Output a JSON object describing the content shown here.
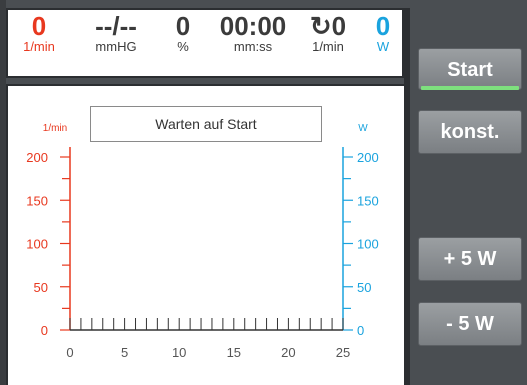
{
  "stats": [
    {
      "value": "0",
      "unit": "1/min",
      "color": "red"
    },
    {
      "value": "--/--",
      "unit": "mmHG",
      "color": "dark"
    },
    {
      "value": "0",
      "unit": "%",
      "color": "dark"
    },
    {
      "value": "00:00",
      "unit": "mm:ss",
      "color": "dark"
    },
    {
      "value": "↻0",
      "unit": "1/min",
      "color": "dark"
    },
    {
      "value": "0",
      "unit": "W",
      "color": "blue"
    }
  ],
  "status_text": "Warten auf Start",
  "buttons": {
    "start": "Start",
    "konst": "konst.",
    "plus5": "+ 5 W",
    "minus5": "- 5 W"
  },
  "colors": {
    "rpm": "#e8381f",
    "watt": "#1aa3de",
    "panel_bg": "#4a4e52",
    "button": "#8b8f92",
    "start_indicator": "#7ee07e"
  },
  "chart_data": {
    "type": "line",
    "title": "",
    "left_axis": {
      "label": "1/min",
      "ticks": [
        "0",
        "50",
        "100",
        "150",
        "200"
      ],
      "range": [
        0,
        200
      ]
    },
    "right_axis": {
      "label": "W",
      "ticks": [
        "0",
        "50",
        "100",
        "150",
        "200"
      ],
      "range": [
        0,
        200
      ]
    },
    "x_axis": {
      "label": "",
      "ticks": [
        "0",
        "5",
        "10",
        "15",
        "20",
        "25"
      ],
      "range": [
        0,
        25
      ]
    },
    "series": []
  }
}
